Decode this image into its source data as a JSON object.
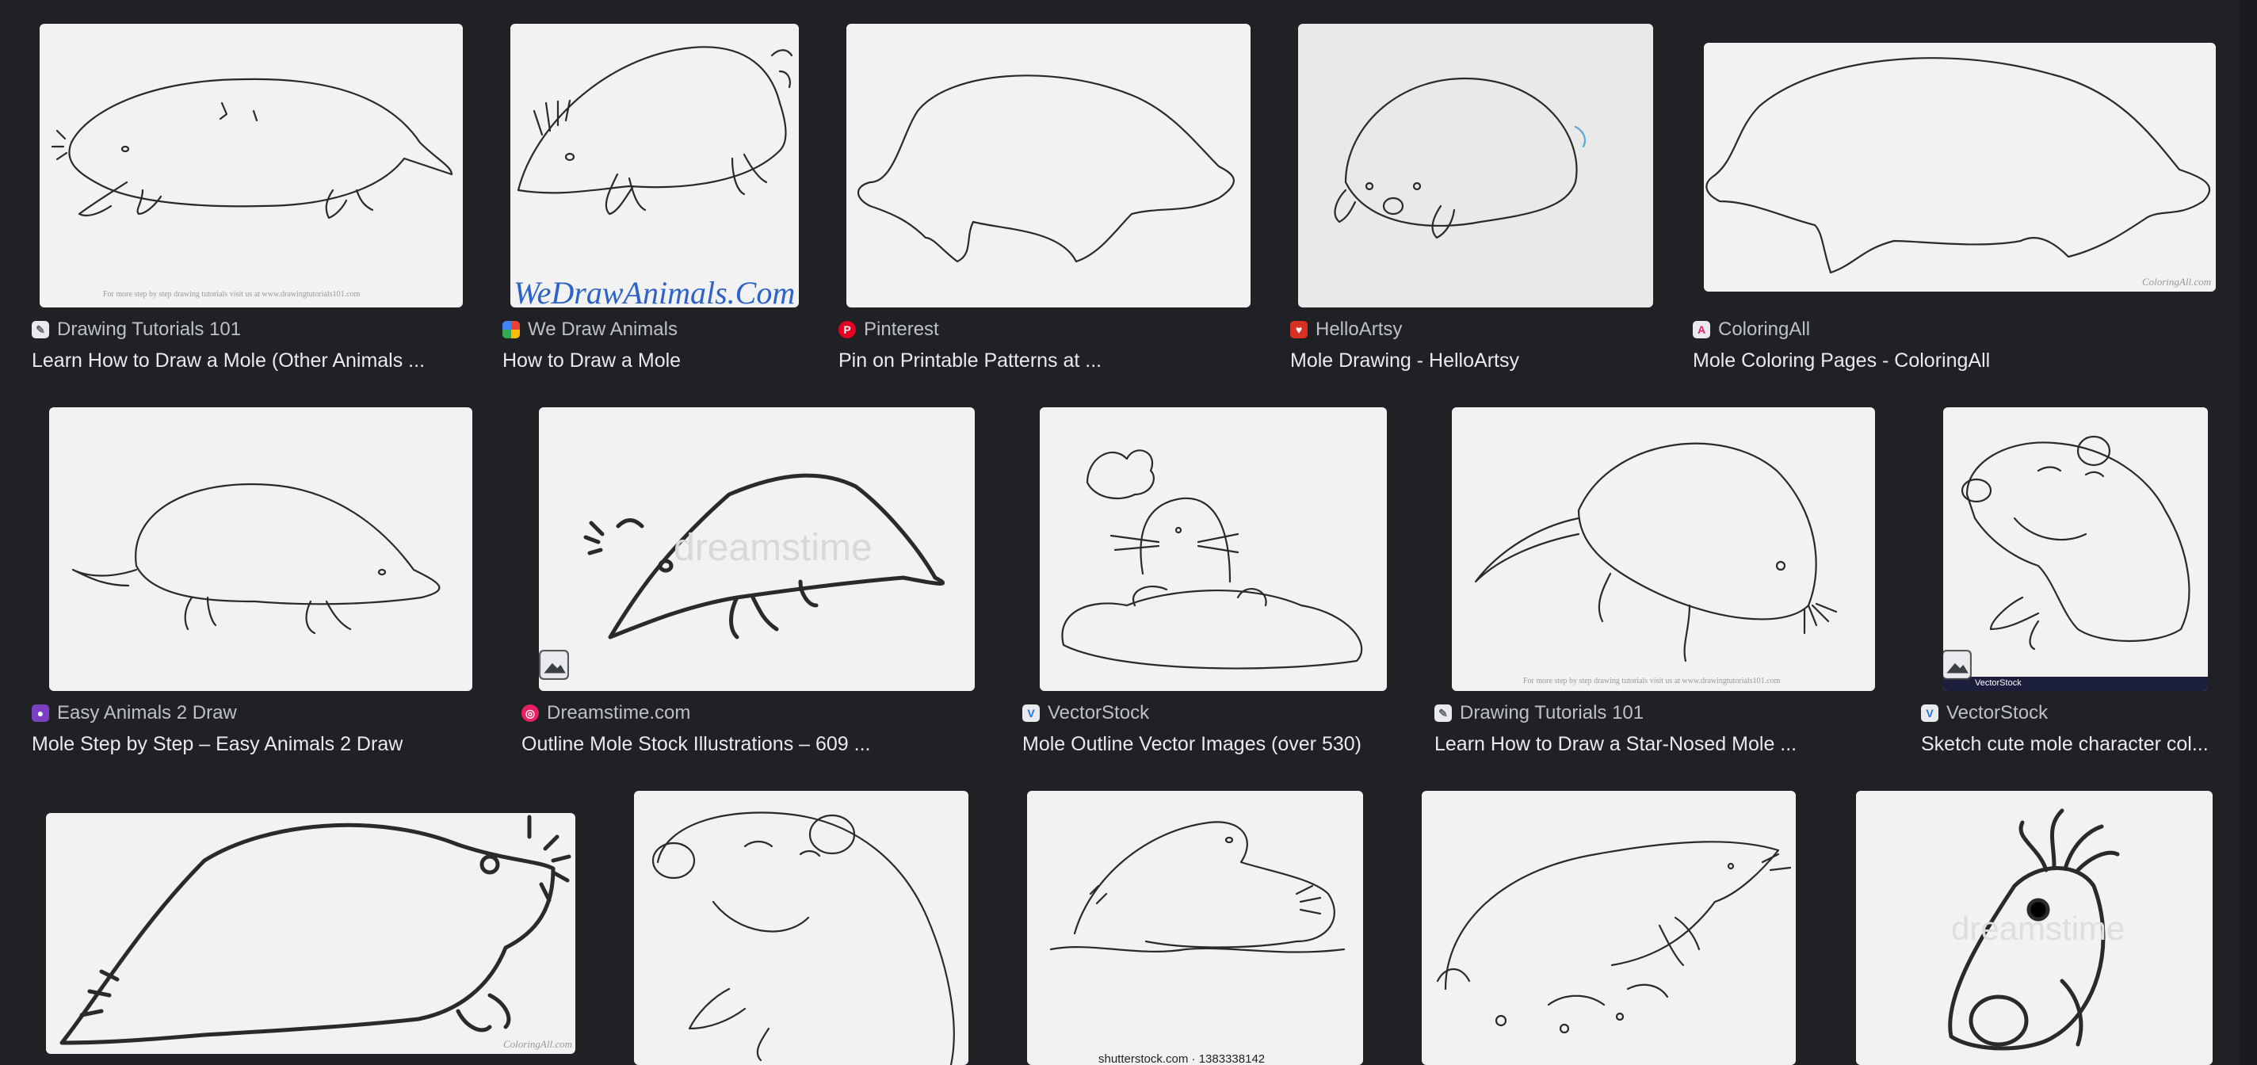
{
  "results": [
    {
      "source": "Drawing Tutorials 101",
      "title": "Learn How to Draw a Mole (Other Animals ..."
    },
    {
      "source": "We Draw Animals",
      "title": "How to Draw a Mole",
      "watermark": "WeDrawAnimals.Com"
    },
    {
      "source": "Pinterest",
      "title": "Pin on Printable Patterns at ..."
    },
    {
      "source": "HelloArtsy",
      "title": "Mole Drawing - HelloArtsy"
    },
    {
      "source": "ColoringAll",
      "title": "Mole Coloring Pages - ColoringAll",
      "watermark": "ColoringAll.com"
    },
    {
      "source": "Easy Animals 2 Draw",
      "title": "Mole Step by Step – Easy Animals 2 Draw"
    },
    {
      "source": "Dreamstime.com",
      "title": "Outline Mole Stock Illustrations – 609 ...",
      "watermark": "dreamstime"
    },
    {
      "source": "VectorStock",
      "title": "Mole Outline Vector Images (over 530)"
    },
    {
      "source": "Drawing Tutorials 101",
      "title": "Learn How to Draw a Star-Nosed Mole ..."
    },
    {
      "source": "VectorStock",
      "title": "Sketch cute mole character col...",
      "watermark": "VectorStock"
    },
    {
      "watermark": "ColoringAll.com"
    },
    {},
    {
      "watermark": "shutterstock.com · 1383338142"
    },
    {},
    {
      "watermark": "dreamstime"
    }
  ]
}
